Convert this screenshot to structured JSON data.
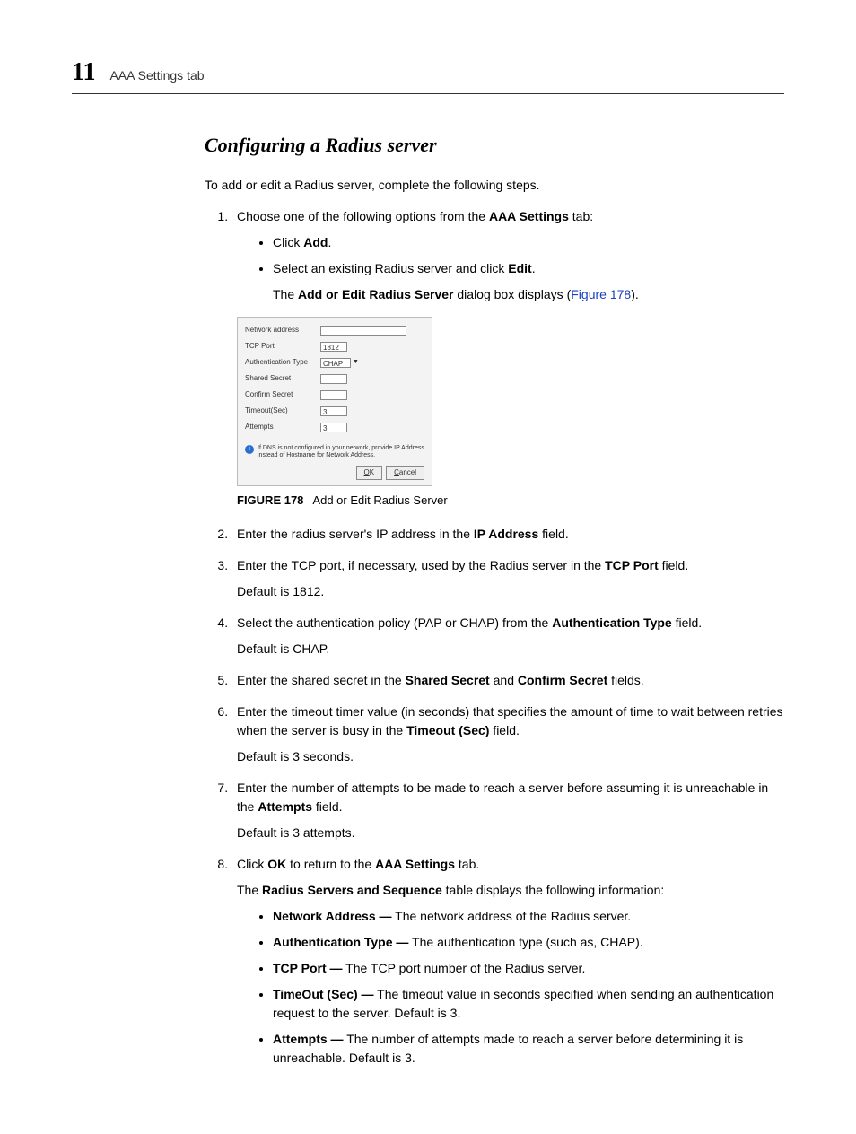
{
  "header": {
    "chapter": "11",
    "title": "AAA Settings tab"
  },
  "section_title": "Configuring a Radius server",
  "intro": "To add or edit a Radius server, complete the following steps.",
  "step1": {
    "lead": "Choose one of the following options from the ",
    "bold": "AAA Settings",
    "tail": " tab:",
    "b1_a": "Click ",
    "b1_b": "Add",
    "b1_c": ".",
    "b2_a": "Select an existing Radius server and click ",
    "b2_b": "Edit",
    "b2_c": ".",
    "after_a": "The ",
    "after_b": "Add or Edit Radius Server",
    "after_c": " dialog box displays (",
    "after_link": "Figure 178",
    "after_d": ")."
  },
  "dialog": {
    "labels": {
      "net": "Network address",
      "tcp": "TCP Port",
      "auth": "Authentication Type",
      "shared": "Shared Secret",
      "confirm": "Confirm Secret",
      "timeout": "Timeout(Sec)",
      "attempts": "Attempts"
    },
    "values": {
      "tcp": "1812",
      "auth": "CHAP",
      "timeout": "3",
      "attempts": "3"
    },
    "hint": "If DNS is not configured in your network, provide IP Address instead of Hostname for Network Address.",
    "ok": "OK",
    "cancel": "Cancel"
  },
  "figure": {
    "label": "FIGURE 178",
    "caption": "Add or Edit Radius Server"
  },
  "step2": {
    "a": "Enter the radius server's IP address in the ",
    "b": "IP Address",
    "c": " field."
  },
  "step3": {
    "a": "Enter the TCP port, if necessary, used by the Radius server in the ",
    "b": "TCP Port",
    "c": " field.",
    "d": "Default is 1812."
  },
  "step4": {
    "a": "Select the authentication policy (PAP or CHAP) from the ",
    "b": "Authentication Type",
    "c": " field.",
    "d": "Default is CHAP."
  },
  "step5": {
    "a": "Enter the shared secret in the ",
    "b": "Shared Secret",
    "c": " and ",
    "d": "Confirm Secret",
    "e": " fields."
  },
  "step6": {
    "a": "Enter the timeout timer value (in seconds) that specifies the amount of time to wait between retries when the server is busy in the ",
    "b": "Timeout (Sec)",
    "c": " field.",
    "d": "Default is 3 seconds."
  },
  "step7": {
    "a": "Enter the number of attempts to be made to reach a server before assuming it is unreachable in the ",
    "b": "Attempts",
    "c": " field.",
    "d": "Default is 3 attempts."
  },
  "step8": {
    "a": "Click ",
    "b": "OK",
    "c": " to return to the ",
    "d": "AAA Settings",
    "e": " tab.",
    "after_a": "The ",
    "after_b": "Radius Servers and Sequence",
    "after_c": " table displays the following information:",
    "items": [
      {
        "label": "Network Address —",
        "text": " The network address of the Radius server."
      },
      {
        "label": "Authentication Type —",
        "text": " The authentication type (such as, CHAP)."
      },
      {
        "label": "TCP Port —",
        "text": " The TCP port number of the Radius server."
      },
      {
        "label": "TimeOut (Sec) —",
        "text": " The timeout value in seconds specified when sending an authentication request to the server. Default is 3."
      },
      {
        "label": "Attempts —",
        "text": " The number of attempts made to reach a server before determining it is unreachable. Default is 3."
      }
    ]
  }
}
